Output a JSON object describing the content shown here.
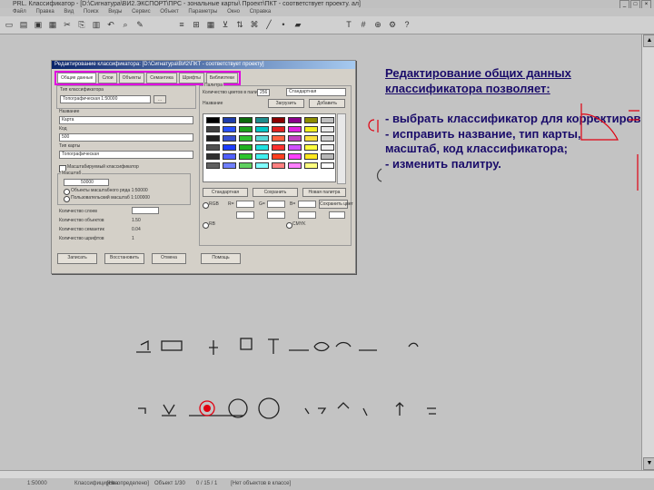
{
  "window": {
    "title": "PRL. Классификатор - [D:\\Сигнатура\\ВИ2.ЭКСПОРТ\\ПРС - зональные карты\\ Проект\\ПКТ - соответствует проекту. ал]",
    "buttons": [
      "_",
      "□",
      "×"
    ]
  },
  "menu": [
    "Файл",
    "Правка",
    "Вид",
    "Поиск",
    "Виды",
    "Сервис",
    "Объект",
    "Параметры",
    "Окно",
    "Справка"
  ],
  "toolbar": {
    "icons": [
      "new-icon",
      "open-icon",
      "save-icon",
      "print-icon",
      "cut-icon",
      "copy-icon",
      "paste-icon",
      "undo-icon",
      "find-icon",
      "edit-icon",
      "list-icon",
      "tree-icon",
      "table-icon",
      "filter-icon",
      "sort-icon",
      "symbol-icon",
      "line-icon",
      "point-icon",
      "area-icon",
      "text-icon",
      "grid-icon",
      "zoom-icon",
      "settings-icon",
      "help-icon"
    ]
  },
  "dialog": {
    "title": "Редактирование классификатора: [D:\\Сигнатура\\ВИ2\\ПКТ - соответствует проекту]",
    "tabs": [
      "Общие данные",
      "Слои",
      "Объекты",
      "Семантика",
      "Шрифты",
      "Библиотеки"
    ],
    "left": {
      "classifier_label": "Тип классификатора",
      "classifier_value": "Топографическая 1:50000",
      "name_label": "Название",
      "name_value": "Карта",
      "code_label": "Код",
      "code_value": "500",
      "maptype_label": "Тип карты",
      "maptype_value": "Топографическая",
      "checkbox_label": "Масштабируемый классификатор",
      "scale_group": "Масштаб",
      "scale_value": "50000",
      "radio1": "Объекты масштабного ряда 1:50000",
      "radio2": "Пользовательский масштаб 1:100000",
      "info1_label": "Количество слоев",
      "info1_value": "",
      "info2_label": "Количество объектов",
      "info2_value": "1.50",
      "info3_label": "Количество семантик",
      "info3_value": "0.04",
      "info4_label": "Количество шрифтов",
      "info4_value": "1"
    },
    "right": {
      "palette_group": "Палитра",
      "palette_count_label": "Количество цветов в палитре",
      "palette_count_value": "256",
      "palette_select": "Стандартная",
      "name_label": "Название",
      "name_btn": "Загрузить",
      "add_btn": "Добавить",
      "btn_standard": "Стандартная",
      "btn_save": "Сохранить",
      "btn_new": "Новая палитра",
      "rgb_label": "RGB",
      "r_label": "R=",
      "g_label": "G=",
      "b_label": "B=",
      "rgb_btn": "Сохранить цвет",
      "cmyk_label": "CMYK",
      "rb_label": "RB"
    },
    "buttons": [
      "Записать",
      "Восстановить",
      "Отмена",
      "Помощь"
    ]
  },
  "palette_colors": [
    "#000000",
    "#1e3caa",
    "#0b6a0b",
    "#1e8c8c",
    "#8a0000",
    "#8a008a",
    "#8c8c00",
    "#c0c0c0",
    "#404040",
    "#2850ff",
    "#1ca21c",
    "#00c8c8",
    "#e02020",
    "#e020e0",
    "#f2f020",
    "#e8e8e8",
    "#202020",
    "#3850d0",
    "#30c030",
    "#58d8d8",
    "#ff6040",
    "#c040c0",
    "#f8e040",
    "#d0d0d0",
    "#505050",
    "#1c3cff",
    "#20b020",
    "#20e0e0",
    "#ff3030",
    "#d050ff",
    "#ffff40",
    "#f0f0f0",
    "#303030",
    "#5060ff",
    "#2ec42e",
    "#40f0f0",
    "#ff4020",
    "#ff40ff",
    "#ffe820",
    "#b8b8b8",
    "#606060",
    "#7080ff",
    "#60d060",
    "#80ffff",
    "#ff8080",
    "#ff80ff",
    "#ffff80",
    "#ffffff"
  ],
  "note": {
    "heading": "Редактирование общих данных классификатора позволяет:",
    "lines": [
      "- выбрать классификатор для корректировки;",
      "- исправить название, тип карты,",
      "масштаб, код классификатора;",
      "- изменить палитру."
    ]
  },
  "status": {
    "s1": "1:50000",
    "s2": "Классифицирова",
    "s3": "[Не определено]",
    "s4": "Объект 1/30",
    "s5": "0 / 15 / 1",
    "s6": "[Нет объектов в классе]"
  },
  "colors": {
    "accent_pink": "#e000e0",
    "annotation_red": "#e00010",
    "note_text": "#1a0c6a"
  }
}
